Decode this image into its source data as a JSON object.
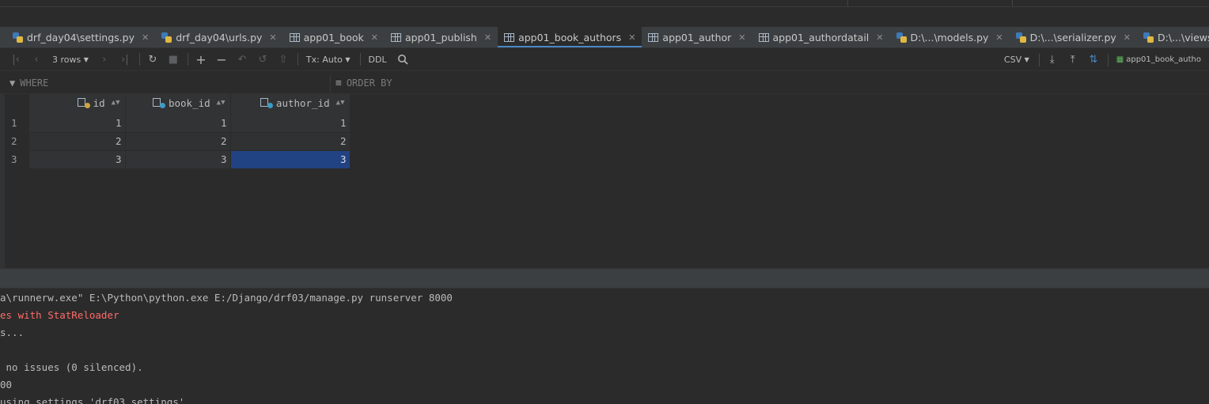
{
  "tabs": [
    {
      "label": "drf_day04\\settings.py",
      "icon": "python-file-icon",
      "active": false
    },
    {
      "label": "drf_day04\\urls.py",
      "icon": "python-file-icon",
      "active": false
    },
    {
      "label": "app01_book",
      "icon": "table-icon",
      "active": false
    },
    {
      "label": "app01_publish",
      "icon": "table-icon",
      "active": false
    },
    {
      "label": "app01_book_authors",
      "icon": "table-icon",
      "active": true
    },
    {
      "label": "app01_author",
      "icon": "table-icon",
      "active": false
    },
    {
      "label": "app01_authordatail",
      "icon": "table-icon",
      "active": false
    },
    {
      "label": "D:\\...\\models.py",
      "icon": "python-file-icon",
      "active": false
    },
    {
      "label": "D:\\...\\serializer.py",
      "icon": "python-file-icon",
      "active": false
    },
    {
      "label": "D:\\...\\views.py",
      "icon": "python-file-icon",
      "active": false
    }
  ],
  "toolbar": {
    "rows_label": "3 rows",
    "tx_label": "Tx: Auto",
    "ddl_label": "DDL",
    "csv_label": "CSV",
    "table_ref": "app01_book_autho"
  },
  "filter": {
    "where_label": "WHERE",
    "orderby_label": "ORDER BY"
  },
  "grid": {
    "columns": [
      "id",
      "book_id",
      "author_id"
    ],
    "rows": [
      {
        "num": "1",
        "id": "1",
        "book_id": "1",
        "author_id": "1"
      },
      {
        "num": "2",
        "id": "2",
        "book_id": "2",
        "author_id": "2"
      },
      {
        "num": "3",
        "id": "3",
        "book_id": "3",
        "author_id": "3"
      }
    ],
    "selected_cell": "row 3, author_id"
  },
  "console": {
    "lines": [
      {
        "text": "a\\runnerw.exe\" E:\\Python\\python.exe E:/Django/drf03/manage.py runserver 8000",
        "color": "#bbbbbb"
      },
      {
        "text": "es with StatReloader",
        "color": "#ff6b68"
      },
      {
        "text": "s...",
        "color": "#bbbbbb"
      },
      {
        "text": "",
        "color": "#bbbbbb"
      },
      {
        "text": " no issues (0 silenced).",
        "color": "#bbbbbb"
      },
      {
        "text": "00",
        "color": "#bbbbbb"
      },
      {
        "text": "using settings 'drf03.settings'",
        "color": "#bbbbbb"
      }
    ]
  },
  "colors": {
    "accent": "#4a88c7",
    "selection": "#214283",
    "error": "#ff6b68"
  }
}
